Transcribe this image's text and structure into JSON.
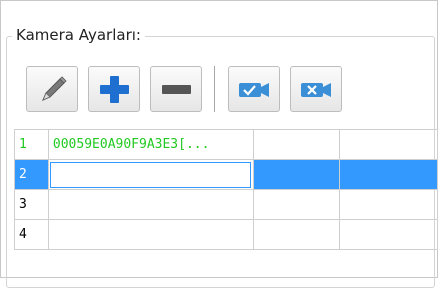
{
  "group": {
    "title": "Kamera Ayarları:"
  },
  "toolbar": {
    "buttons": [
      {
        "name": "edit",
        "icon": "pencil-icon"
      },
      {
        "name": "add",
        "icon": "plus-icon"
      },
      {
        "name": "remove",
        "icon": "minus-icon"
      },
      {
        "name": "confirm",
        "icon": "camera-check-icon"
      },
      {
        "name": "cancel",
        "icon": "camera-cross-icon"
      }
    ]
  },
  "grid": {
    "rows": [
      {
        "num": "1",
        "cells": [
          "00059E0A90F9A3E3[...",
          "",
          ""
        ]
      },
      {
        "num": "2",
        "cells": [
          "",
          "",
          ""
        ]
      },
      {
        "num": "3",
        "cells": [
          "",
          "",
          ""
        ]
      },
      {
        "num": "4",
        "cells": [
          "",
          "",
          ""
        ]
      }
    ]
  },
  "colors": {
    "selection": "#3399ff",
    "active_text": "#22c922",
    "icon_blue": "#1e88e5"
  }
}
